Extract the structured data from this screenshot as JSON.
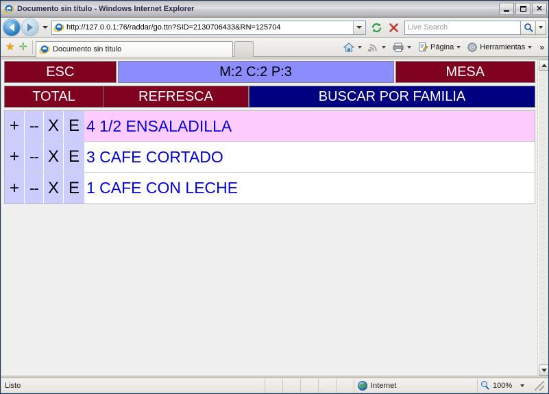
{
  "window": {
    "title": "Documento sin título - Windows Internet Explorer",
    "minimize_label": "Minimizar",
    "maximize_label": "Maximizar",
    "close_label": "Cerrar"
  },
  "address_bar": {
    "url": "http://127.0.0.1:76/raddar/go.ttn?SID=2130706433&RN=125704",
    "back_label": "Atrás",
    "forward_label": "Adelante",
    "refresh_label": "Actualizar",
    "stop_label": "Detener",
    "search_placeholder": "Live Search",
    "search_value": ""
  },
  "command_bar": {
    "favorites_label": "Favoritos",
    "add_favorite_label": "Agregar a Favoritos",
    "tab_title": "Documento sin título",
    "new_tab_label": "",
    "home_label": "Página principal",
    "feeds_label": "Fuentes",
    "print_label": "Imprimir",
    "page_label": "Página",
    "tools_label": "Herramientas",
    "overflow_label": "»"
  },
  "pos": {
    "header_rows": [
      {
        "cells": [
          {
            "label": "ESC",
            "style": "dark",
            "name": "esc-button"
          },
          {
            "label": "M:2 C:2 P:3",
            "style": "periwinkle",
            "name": "table-info-display"
          },
          {
            "label": "MESA",
            "style": "dark",
            "name": "mesa-button"
          }
        ]
      },
      {
        "cells": [
          {
            "label": "TOTAL",
            "style": "dark",
            "name": "total-button"
          },
          {
            "label": "REFRESCA",
            "style": "dark",
            "name": "refresca-button"
          },
          {
            "label": "BUSCAR POR FAMILIA",
            "style": "navy",
            "name": "buscar-por-familia-button"
          }
        ]
      }
    ],
    "row_buttons": {
      "increase": "+",
      "decrease": "--",
      "delete": "X",
      "edit": "E"
    },
    "order_items": [
      {
        "text": "4 1/2 ENSALADILLA",
        "selected": true
      },
      {
        "text": "3 CAFE CORTADO",
        "selected": false
      },
      {
        "text": "1 CAFE CON LECHE",
        "selected": false
      }
    ]
  },
  "status_bar": {
    "status": "Listo",
    "zone": "Internet",
    "zoom": "100%"
  },
  "colors": {
    "dark_red": "#800020",
    "navy": "#000080",
    "periwinkle": "#8c8cff",
    "selected_row": "#ffccff",
    "button_lavender": "#ccccff",
    "item_text": "#0000dd"
  }
}
